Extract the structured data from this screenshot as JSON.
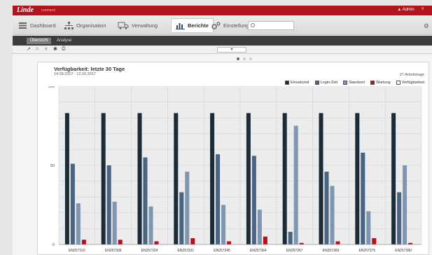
{
  "topbar": {
    "brand": "Linde",
    "brand_sub": "connect:",
    "user": "▲ Admin",
    "menu": "?"
  },
  "nav": {
    "items": [
      {
        "label": "Dashboard",
        "icon": "grid-icon"
      },
      {
        "label": "Organisation",
        "icon": "org-chart-icon"
      },
      {
        "label": "Verwaltung",
        "icon": "truck-icon"
      },
      {
        "label": "Berichte",
        "icon": "bar-chart-icon"
      },
      {
        "label": "Einstellungen",
        "icon": "gears-icon"
      }
    ],
    "search_placeholder": ""
  },
  "subtabs": [
    "Übersicht",
    "Analyse"
  ],
  "toolbar": {
    "collapse": "▾"
  },
  "chart_data": {
    "type": "bar",
    "title": "Verfügbarkeit: letzte 30 Tage",
    "subtitle": "14.09.2017 - 12.10.2017",
    "period_note": "27 Arbeitstage",
    "legend_position": "top-right",
    "grid": true,
    "ylim": [
      0,
      100
    ],
    "yticks": [
      0,
      50,
      100
    ],
    "categories": [
      "EN257310",
      "EN257306",
      "EN257324",
      "EN257331",
      "EN257345",
      "EN257364",
      "EN257367",
      "EN257369",
      "EN257375",
      "EN257380"
    ],
    "series": [
      {
        "name": "Einsatzzeit",
        "color": "#1c2b38",
        "values": [
          83,
          83,
          83,
          83,
          83,
          83,
          83,
          83,
          83,
          83
        ]
      },
      {
        "name": "Login-Zeit",
        "color": "#4a6484",
        "values": [
          51,
          50,
          55,
          33,
          57,
          56,
          8,
          46,
          58,
          33
        ]
      },
      {
        "name": "Standzeit",
        "color": "#7f96b2",
        "values": [
          26,
          27,
          24,
          46,
          25,
          22,
          75,
          37,
          21,
          50
        ]
      },
      {
        "name": "Wartung",
        "color": "#b3121c",
        "values": [
          3,
          3,
          2,
          4,
          2,
          5,
          1,
          2,
          4,
          1
        ]
      },
      {
        "name": "Verfügbarkeit",
        "color": "#ffffff",
        "values": [
          0,
          0,
          0,
          0,
          0,
          0,
          0,
          0,
          0,
          0
        ]
      }
    ]
  }
}
